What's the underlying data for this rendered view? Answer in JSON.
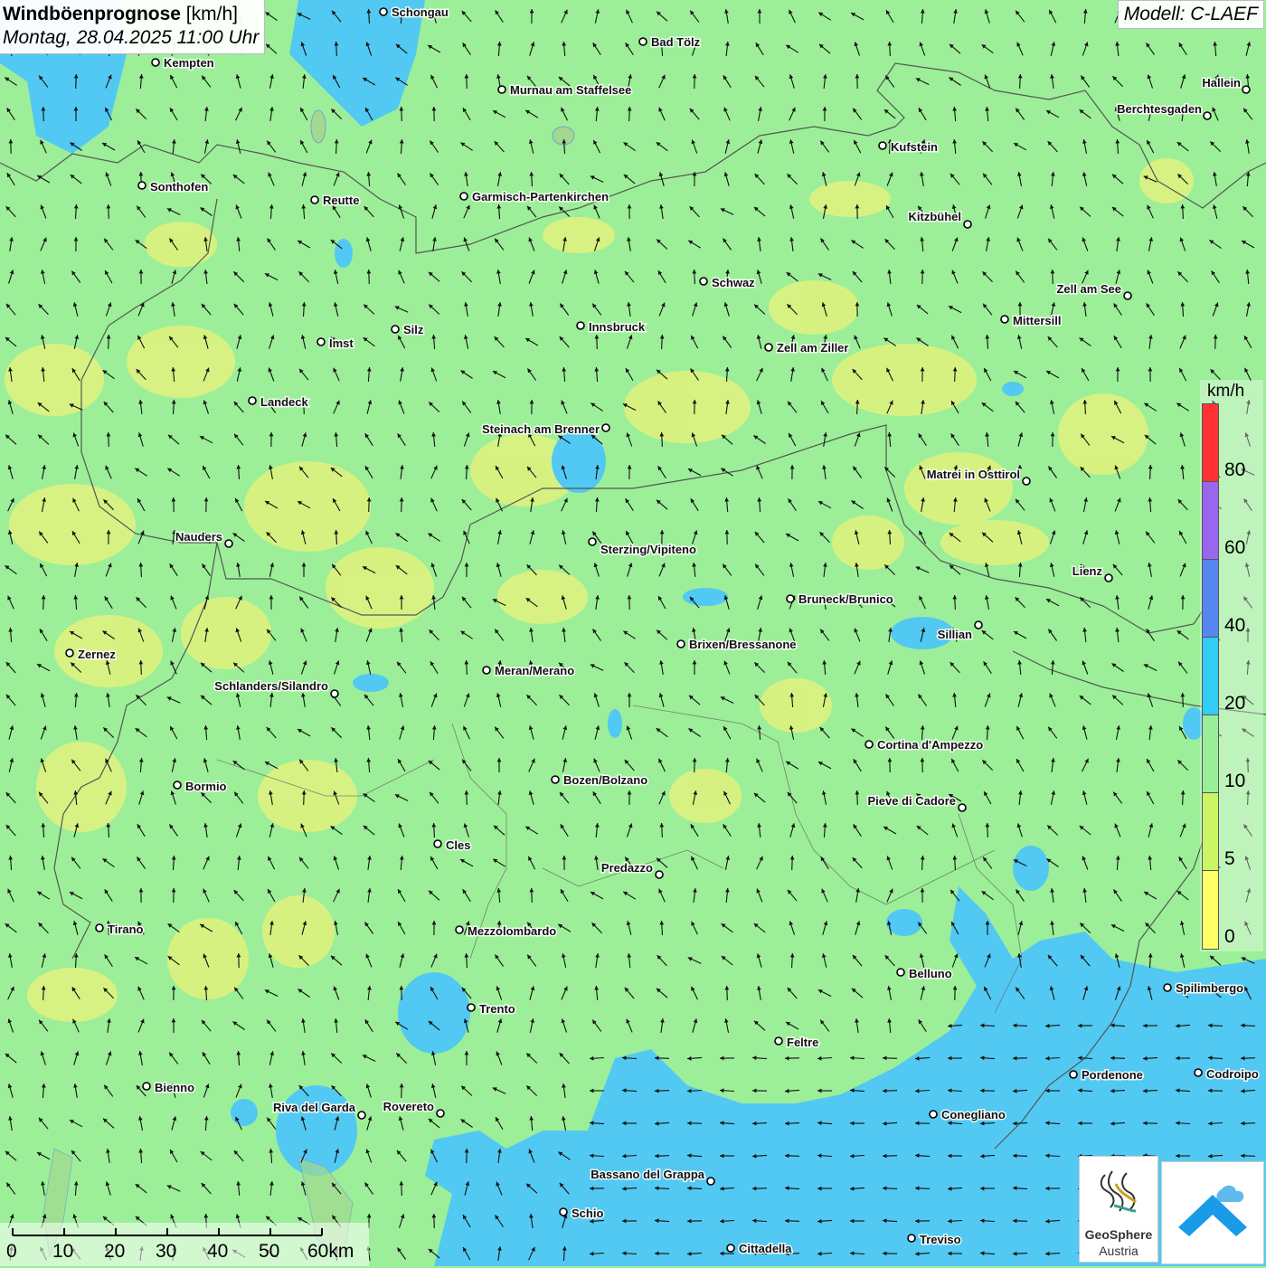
{
  "header": {
    "title_bold": "Windböenprognose",
    "title_unit": " [km/h]",
    "datetime": "Montag, 28.04.2025 11:00 Uhr",
    "model": "Modell: C-LAEF"
  },
  "colors": {
    "land_base": "#9cef98",
    "calm_yellow": "#f0f07a",
    "light_green": "#c8f27a",
    "gust_blue": "#4fc8f0",
    "border": "#555555"
  },
  "legend": {
    "unit": "km/h",
    "bands": [
      {
        "label": "80",
        "color": "#ff3333"
      },
      {
        "label": "60",
        "color": "#9966ee"
      },
      {
        "label": "40",
        "color": "#5588ee"
      },
      {
        "label": "20",
        "color": "#33ccf5"
      },
      {
        "label": "10",
        "color": "#99ee99"
      },
      {
        "label": "5",
        "color": "#ccf566"
      },
      {
        "label": "0",
        "color": "#ffff66"
      }
    ]
  },
  "scale_bar": {
    "labels": [
      "0",
      "10",
      "20",
      "30",
      "40",
      "50",
      "60km"
    ]
  },
  "cities": [
    {
      "name": "Schongau"
    },
    {
      "name": "Kempten"
    },
    {
      "name": "Bad Tölz"
    },
    {
      "name": "Murnau am Staffelsee"
    },
    {
      "name": "Hallein"
    },
    {
      "name": "Berchtesgaden"
    },
    {
      "name": "Kufstein"
    },
    {
      "name": "Sonthofen"
    },
    {
      "name": "Reutte"
    },
    {
      "name": "Garmisch-Partenkirchen"
    },
    {
      "name": "Kitzbühel"
    },
    {
      "name": "Schwaz"
    },
    {
      "name": "Zell am See"
    },
    {
      "name": "Innsbruck"
    },
    {
      "name": "Silz"
    },
    {
      "name": "Imst"
    },
    {
      "name": "Mittersill"
    },
    {
      "name": "Zell am Ziller"
    },
    {
      "name": "Landeck"
    },
    {
      "name": "Steinach am Brenner"
    },
    {
      "name": "Matrei in Osttirol"
    },
    {
      "name": "Nauders"
    },
    {
      "name": "Sterzing/Vipiteno"
    },
    {
      "name": "Lienz"
    },
    {
      "name": "Bruneck/Brunico"
    },
    {
      "name": "Sillian"
    },
    {
      "name": "Brixen/Bressanone"
    },
    {
      "name": "Zernez"
    },
    {
      "name": "Meran/Merano"
    },
    {
      "name": "Schlanders/Silandro"
    },
    {
      "name": "Cortina d'Ampezzo"
    },
    {
      "name": "Bozen/Bolzano"
    },
    {
      "name": "Bormio"
    },
    {
      "name": "Pieve di Cadore"
    },
    {
      "name": "Cles"
    },
    {
      "name": "Predazzo"
    },
    {
      "name": "Tirano"
    },
    {
      "name": "Mezzolombardo"
    },
    {
      "name": "Belluno"
    },
    {
      "name": "Spilimbergo"
    },
    {
      "name": "Trento"
    },
    {
      "name": "Feltre"
    },
    {
      "name": "Pordenone"
    },
    {
      "name": "Codroipo"
    },
    {
      "name": "Bienno"
    },
    {
      "name": "Riva del Garda"
    },
    {
      "name": "Rovereto"
    },
    {
      "name": "Conegliano"
    },
    {
      "name": "Bassano del Grappa"
    },
    {
      "name": "Schio"
    },
    {
      "name": "Treviso"
    },
    {
      "name": "Cittadella"
    }
  ],
  "logos": {
    "geosphere_line1": "GeoSphere",
    "geosphere_line2": "Austria"
  }
}
